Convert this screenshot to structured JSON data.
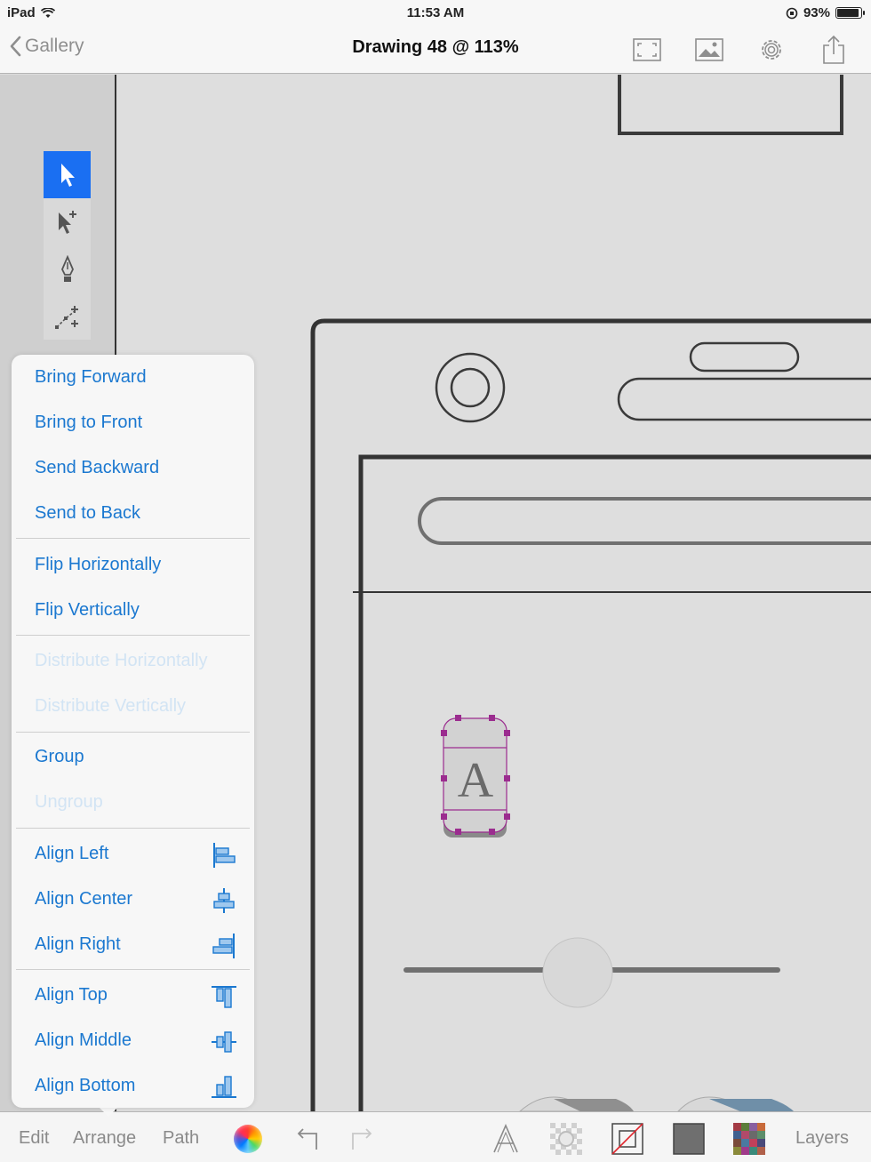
{
  "status_bar": {
    "device": "iPad",
    "time": "11:53 AM",
    "battery": "93%"
  },
  "nav": {
    "back_label": "Gallery",
    "title": "Drawing 48 @ 113%",
    "icons": [
      "fullscreen-icon",
      "image-icon",
      "settings-gear-icon",
      "share-icon"
    ]
  },
  "tools": [
    "select-arrow-icon",
    "direct-select-icon",
    "pen-tool-icon",
    "node-edit-icon"
  ],
  "arrange_menu": {
    "items": [
      {
        "label": "Bring Forward",
        "enabled": true
      },
      {
        "label": "Bring to Front",
        "enabled": true
      },
      {
        "label": "Send Backward",
        "enabled": true
      },
      {
        "label": "Send to Back",
        "enabled": true
      },
      {
        "label": "Flip Horizontally",
        "enabled": true
      },
      {
        "label": "Flip Vertically",
        "enabled": true
      },
      {
        "label": "Distribute Horizontally",
        "enabled": false
      },
      {
        "label": "Distribute Vertically",
        "enabled": false
      },
      {
        "label": "Group",
        "enabled": true
      },
      {
        "label": "Ungroup",
        "enabled": false
      },
      {
        "label": "Align Left",
        "enabled": true,
        "icon": "align-left-icon"
      },
      {
        "label": "Align Center",
        "enabled": true,
        "icon": "align-center-icon"
      },
      {
        "label": "Align Right",
        "enabled": true,
        "icon": "align-right-icon"
      },
      {
        "label": "Align Top",
        "enabled": true,
        "icon": "align-top-icon"
      },
      {
        "label": "Align Middle",
        "enabled": true,
        "icon": "align-middle-icon"
      },
      {
        "label": "Align Bottom",
        "enabled": true,
        "icon": "align-bottom-icon"
      }
    ]
  },
  "canvas": {
    "selected_glyph": "A"
  },
  "bottom_bar": {
    "tabs": [
      "Edit",
      "Arrange",
      "Path"
    ],
    "layers_label": "Layers",
    "icons": [
      "color-wheel-icon",
      "undo-icon",
      "redo-icon",
      "text-style-icon",
      "shadow-icon",
      "stroke-icon",
      "fill-icon",
      "pattern-icon"
    ]
  },
  "colors": {
    "accent": "#1b78d0",
    "tool_active": "#1a6ff2",
    "selection": "#9b2c8f"
  }
}
